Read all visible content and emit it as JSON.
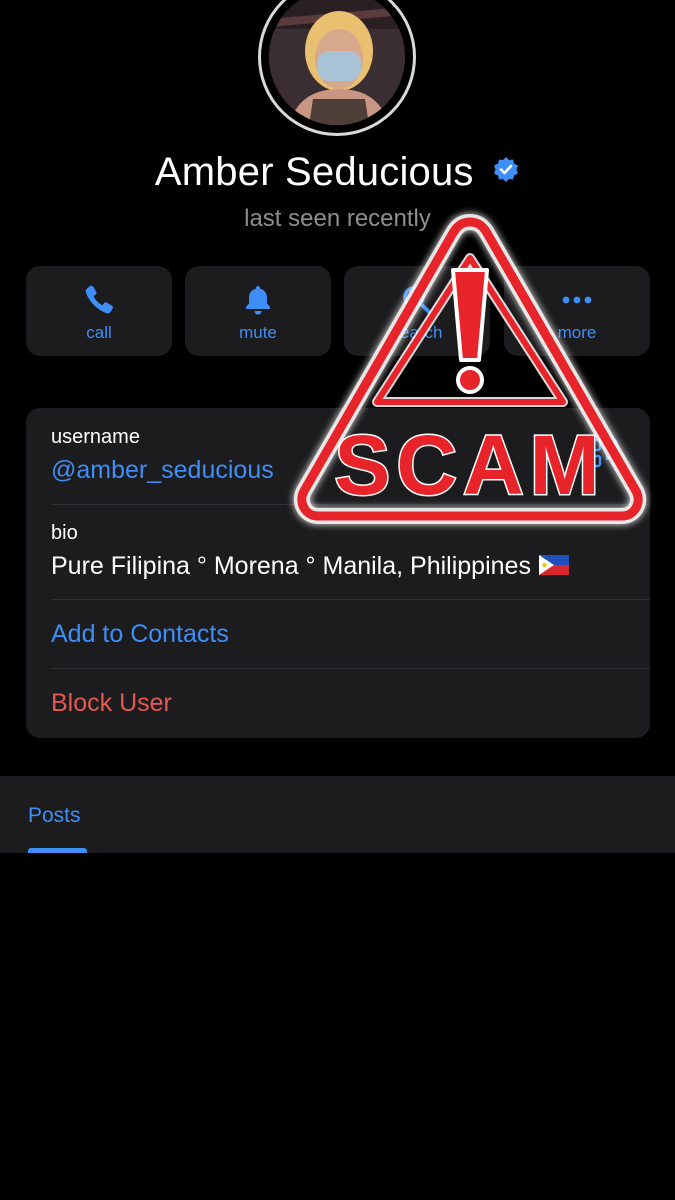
{
  "profile": {
    "name": "Amber Seducious",
    "status": "last seen recently",
    "verified": true
  },
  "actions": [
    {
      "label": "call",
      "icon": "phone-icon"
    },
    {
      "label": "mute",
      "icon": "bell-icon"
    },
    {
      "label": "search",
      "icon": "search-icon"
    },
    {
      "label": "more",
      "icon": "more-icon"
    }
  ],
  "info": {
    "username_label": "username",
    "username_value": "@amber_seducious",
    "bio_label": "bio",
    "bio_value": "Pure Filipina ° Morena ° Manila, Philippines",
    "bio_flag": "philippines-flag-icon",
    "add_contacts": "Add to Contacts",
    "block_user": "Block User"
  },
  "tabs": {
    "posts": "Posts"
  },
  "overlay": {
    "stamp_text": "SCAM"
  },
  "colors": {
    "background": "#000000",
    "card": "#1c1c1e",
    "accent": "#3e8ef7",
    "danger": "#e5584f",
    "muted": "#8e8e93",
    "stamp_red": "#e8242b"
  }
}
